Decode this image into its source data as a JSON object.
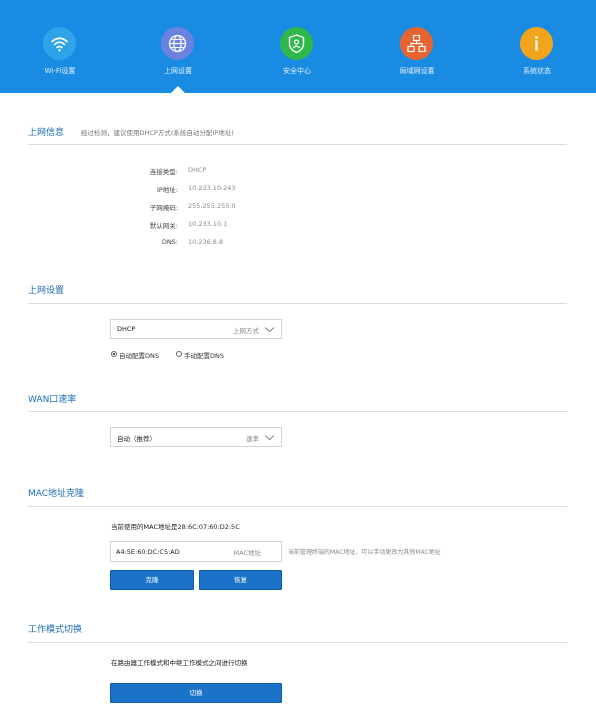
{
  "nav": {
    "items": [
      {
        "label": "Wi-Fi设置",
        "icon": "wifi-icon",
        "color": "#2fa3e8"
      },
      {
        "label": "上网设置",
        "icon": "globe-icon",
        "color": "#6a82e0"
      },
      {
        "label": "安全中心",
        "icon": "shield-icon",
        "color": "#2fb84a"
      },
      {
        "label": "局域网设置",
        "icon": "network-icon",
        "color": "#e8642e"
      },
      {
        "label": "系统状态",
        "icon": "info-icon",
        "color": "#f2a51c"
      }
    ],
    "active_index": 1,
    "bg_color": "#1a8be3"
  },
  "internet_info": {
    "title": "上网信息",
    "subtitle": "经过检测，建议使用DHCP方式(系统自动分配IP地址)",
    "rows": [
      {
        "key": "连接类型:",
        "value": "DHCP"
      },
      {
        "key": "IP地址:",
        "value": "10.233.10.243"
      },
      {
        "key": "子网掩码:",
        "value": "255.255.255.0"
      },
      {
        "key": "默认网关:",
        "value": "10.233.10.1"
      },
      {
        "key": "DNS:",
        "value": "10.236.8.8"
      }
    ]
  },
  "internet_settings": {
    "title": "上网设置",
    "mode_value": "DHCP",
    "mode_hint": "上网方式",
    "dns_options": [
      {
        "label": "自动配置DNS",
        "selected": true
      },
      {
        "label": "手动配置DNS",
        "selected": false
      }
    ]
  },
  "wan_speed": {
    "title": "WAN口速率",
    "value": "自动（推荐）",
    "hint": "速率"
  },
  "mac_clone": {
    "title": "MAC地址克隆",
    "current_text": "当前使用的MAC地址是28:6C:07:60:D2:5C",
    "input_value": "A4:5E:60:DC:C5:AD",
    "input_hint": "MAC地址",
    "note": "当前管理终端的MAC地址，可以手动更改为其他MAC地址",
    "clone_label": "克隆",
    "restore_label": "恢复"
  },
  "work_mode": {
    "title": "工作模式切换",
    "description": "在路由器工作模式和中继工作模式之间进行切换",
    "switch_label": "切换"
  },
  "accent_color": "#1a72c9"
}
